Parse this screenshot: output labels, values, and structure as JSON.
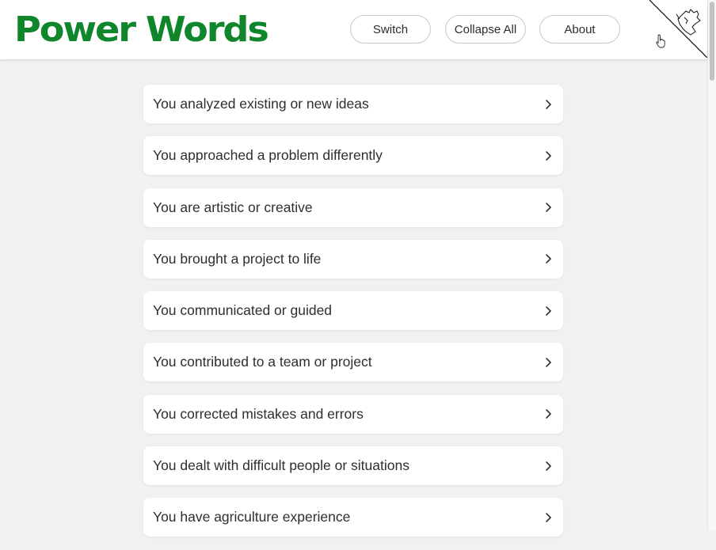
{
  "header": {
    "logo": "Power Words",
    "buttons": {
      "switch": "Switch",
      "collapse_all": "Collapse All",
      "about": "About"
    }
  },
  "colors": {
    "brand": "#10862b",
    "background": "#f1f1f1",
    "card": "#ffffff",
    "text": "#2e2e2e"
  },
  "items": [
    {
      "label": "You analyzed existing or new ideas",
      "icon": "chevron-right-icon"
    },
    {
      "label": "You approached a problem differently",
      "icon": "chevron-right-icon"
    },
    {
      "label": "You are artistic or creative",
      "icon": "chevron-right-icon"
    },
    {
      "label": "You brought a project to life",
      "icon": "chevron-right-icon"
    },
    {
      "label": "You communicated or guided",
      "icon": "chevron-right-icon"
    },
    {
      "label": "You contributed to a team or project",
      "icon": "chevron-right-icon"
    },
    {
      "label": "You corrected mistakes and errors",
      "icon": "chevron-right-icon"
    },
    {
      "label": "You dealt with difficult people or situations",
      "icon": "chevron-right-icon"
    },
    {
      "label": "You have agriculture experience",
      "icon": "chevron-right-icon"
    }
  ]
}
